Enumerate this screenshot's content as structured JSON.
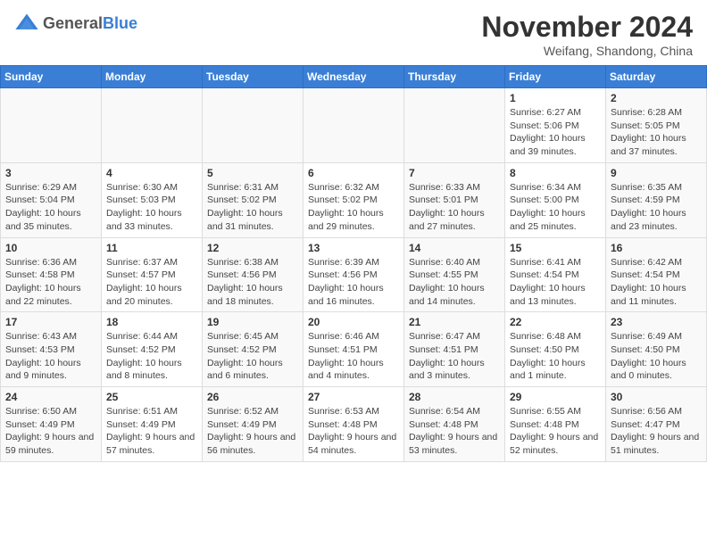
{
  "header": {
    "logo_general": "General",
    "logo_blue": "Blue",
    "month_title": "November 2024",
    "location": "Weifang, Shandong, China"
  },
  "days_of_week": [
    "Sunday",
    "Monday",
    "Tuesday",
    "Wednesday",
    "Thursday",
    "Friday",
    "Saturday"
  ],
  "weeks": [
    [
      {
        "num": "",
        "info": ""
      },
      {
        "num": "",
        "info": ""
      },
      {
        "num": "",
        "info": ""
      },
      {
        "num": "",
        "info": ""
      },
      {
        "num": "",
        "info": ""
      },
      {
        "num": "1",
        "info": "Sunrise: 6:27 AM\nSunset: 5:06 PM\nDaylight: 10 hours and 39 minutes."
      },
      {
        "num": "2",
        "info": "Sunrise: 6:28 AM\nSunset: 5:05 PM\nDaylight: 10 hours and 37 minutes."
      }
    ],
    [
      {
        "num": "3",
        "info": "Sunrise: 6:29 AM\nSunset: 5:04 PM\nDaylight: 10 hours and 35 minutes."
      },
      {
        "num": "4",
        "info": "Sunrise: 6:30 AM\nSunset: 5:03 PM\nDaylight: 10 hours and 33 minutes."
      },
      {
        "num": "5",
        "info": "Sunrise: 6:31 AM\nSunset: 5:02 PM\nDaylight: 10 hours and 31 minutes."
      },
      {
        "num": "6",
        "info": "Sunrise: 6:32 AM\nSunset: 5:02 PM\nDaylight: 10 hours and 29 minutes."
      },
      {
        "num": "7",
        "info": "Sunrise: 6:33 AM\nSunset: 5:01 PM\nDaylight: 10 hours and 27 minutes."
      },
      {
        "num": "8",
        "info": "Sunrise: 6:34 AM\nSunset: 5:00 PM\nDaylight: 10 hours and 25 minutes."
      },
      {
        "num": "9",
        "info": "Sunrise: 6:35 AM\nSunset: 4:59 PM\nDaylight: 10 hours and 23 minutes."
      }
    ],
    [
      {
        "num": "10",
        "info": "Sunrise: 6:36 AM\nSunset: 4:58 PM\nDaylight: 10 hours and 22 minutes."
      },
      {
        "num": "11",
        "info": "Sunrise: 6:37 AM\nSunset: 4:57 PM\nDaylight: 10 hours and 20 minutes."
      },
      {
        "num": "12",
        "info": "Sunrise: 6:38 AM\nSunset: 4:56 PM\nDaylight: 10 hours and 18 minutes."
      },
      {
        "num": "13",
        "info": "Sunrise: 6:39 AM\nSunset: 4:56 PM\nDaylight: 10 hours and 16 minutes."
      },
      {
        "num": "14",
        "info": "Sunrise: 6:40 AM\nSunset: 4:55 PM\nDaylight: 10 hours and 14 minutes."
      },
      {
        "num": "15",
        "info": "Sunrise: 6:41 AM\nSunset: 4:54 PM\nDaylight: 10 hours and 13 minutes."
      },
      {
        "num": "16",
        "info": "Sunrise: 6:42 AM\nSunset: 4:54 PM\nDaylight: 10 hours and 11 minutes."
      }
    ],
    [
      {
        "num": "17",
        "info": "Sunrise: 6:43 AM\nSunset: 4:53 PM\nDaylight: 10 hours and 9 minutes."
      },
      {
        "num": "18",
        "info": "Sunrise: 6:44 AM\nSunset: 4:52 PM\nDaylight: 10 hours and 8 minutes."
      },
      {
        "num": "19",
        "info": "Sunrise: 6:45 AM\nSunset: 4:52 PM\nDaylight: 10 hours and 6 minutes."
      },
      {
        "num": "20",
        "info": "Sunrise: 6:46 AM\nSunset: 4:51 PM\nDaylight: 10 hours and 4 minutes."
      },
      {
        "num": "21",
        "info": "Sunrise: 6:47 AM\nSunset: 4:51 PM\nDaylight: 10 hours and 3 minutes."
      },
      {
        "num": "22",
        "info": "Sunrise: 6:48 AM\nSunset: 4:50 PM\nDaylight: 10 hours and 1 minute."
      },
      {
        "num": "23",
        "info": "Sunrise: 6:49 AM\nSunset: 4:50 PM\nDaylight: 10 hours and 0 minutes."
      }
    ],
    [
      {
        "num": "24",
        "info": "Sunrise: 6:50 AM\nSunset: 4:49 PM\nDaylight: 9 hours and 59 minutes."
      },
      {
        "num": "25",
        "info": "Sunrise: 6:51 AM\nSunset: 4:49 PM\nDaylight: 9 hours and 57 minutes."
      },
      {
        "num": "26",
        "info": "Sunrise: 6:52 AM\nSunset: 4:49 PM\nDaylight: 9 hours and 56 minutes."
      },
      {
        "num": "27",
        "info": "Sunrise: 6:53 AM\nSunset: 4:48 PM\nDaylight: 9 hours and 54 minutes."
      },
      {
        "num": "28",
        "info": "Sunrise: 6:54 AM\nSunset: 4:48 PM\nDaylight: 9 hours and 53 minutes."
      },
      {
        "num": "29",
        "info": "Sunrise: 6:55 AM\nSunset: 4:48 PM\nDaylight: 9 hours and 52 minutes."
      },
      {
        "num": "30",
        "info": "Sunrise: 6:56 AM\nSunset: 4:47 PM\nDaylight: 9 hours and 51 minutes."
      }
    ]
  ]
}
